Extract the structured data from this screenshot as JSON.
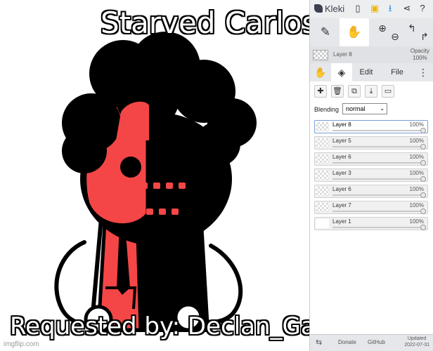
{
  "meme": {
    "top_text": "Starved Carlos",
    "bottom_text": "Requested by: Declan_Game_Studios",
    "watermark": "imgflip.com"
  },
  "colors": {
    "character_red": "#f44646",
    "character_black": "#000000",
    "panel_bg": "#e5e7ea",
    "active_layer_border": "#7a9ed8"
  },
  "app": {
    "name": "Kleki",
    "topbar_icons": [
      "new-file-icon",
      "save-icon",
      "download-icon",
      "share-icon",
      "help-icon"
    ],
    "tools": [
      "brush-icon",
      "hand-icon",
      "zoom-in-icon",
      "zoom-out-icon",
      "undo-icon",
      "redo-icon"
    ]
  },
  "current_layer": {
    "name": "Layer 8",
    "opacity_label": "Opacity",
    "opacity_value": "100%"
  },
  "tabs": {
    "hand": "hand-icon",
    "layers": "layers-icon",
    "edit": "Edit",
    "file": "File",
    "more": "more-icon"
  },
  "layer_actions": [
    "add-layer-icon",
    "delete-layer-icon",
    "duplicate-layer-icon",
    "merge-down-icon",
    "rename-layer-icon"
  ],
  "blending": {
    "label": "Blending",
    "value": "normal"
  },
  "layers": [
    {
      "name": "Layer 8",
      "opacity": "100%",
      "active": true
    },
    {
      "name": "Layer 5",
      "opacity": "100%",
      "active": false
    },
    {
      "name": "Layer 6",
      "opacity": "100%",
      "active": false
    },
    {
      "name": "Layer 3",
      "opacity": "100%",
      "active": false
    },
    {
      "name": "Layer 6",
      "opacity": "100%",
      "active": false
    },
    {
      "name": "Layer 7",
      "opacity": "100%",
      "active": false
    },
    {
      "name": "Layer 1",
      "opacity": "100%",
      "active": false
    }
  ],
  "bottom": {
    "donate": "Donate",
    "github": "GitHub",
    "updated_label": "Updated",
    "updated_date": "2022-07-31"
  }
}
